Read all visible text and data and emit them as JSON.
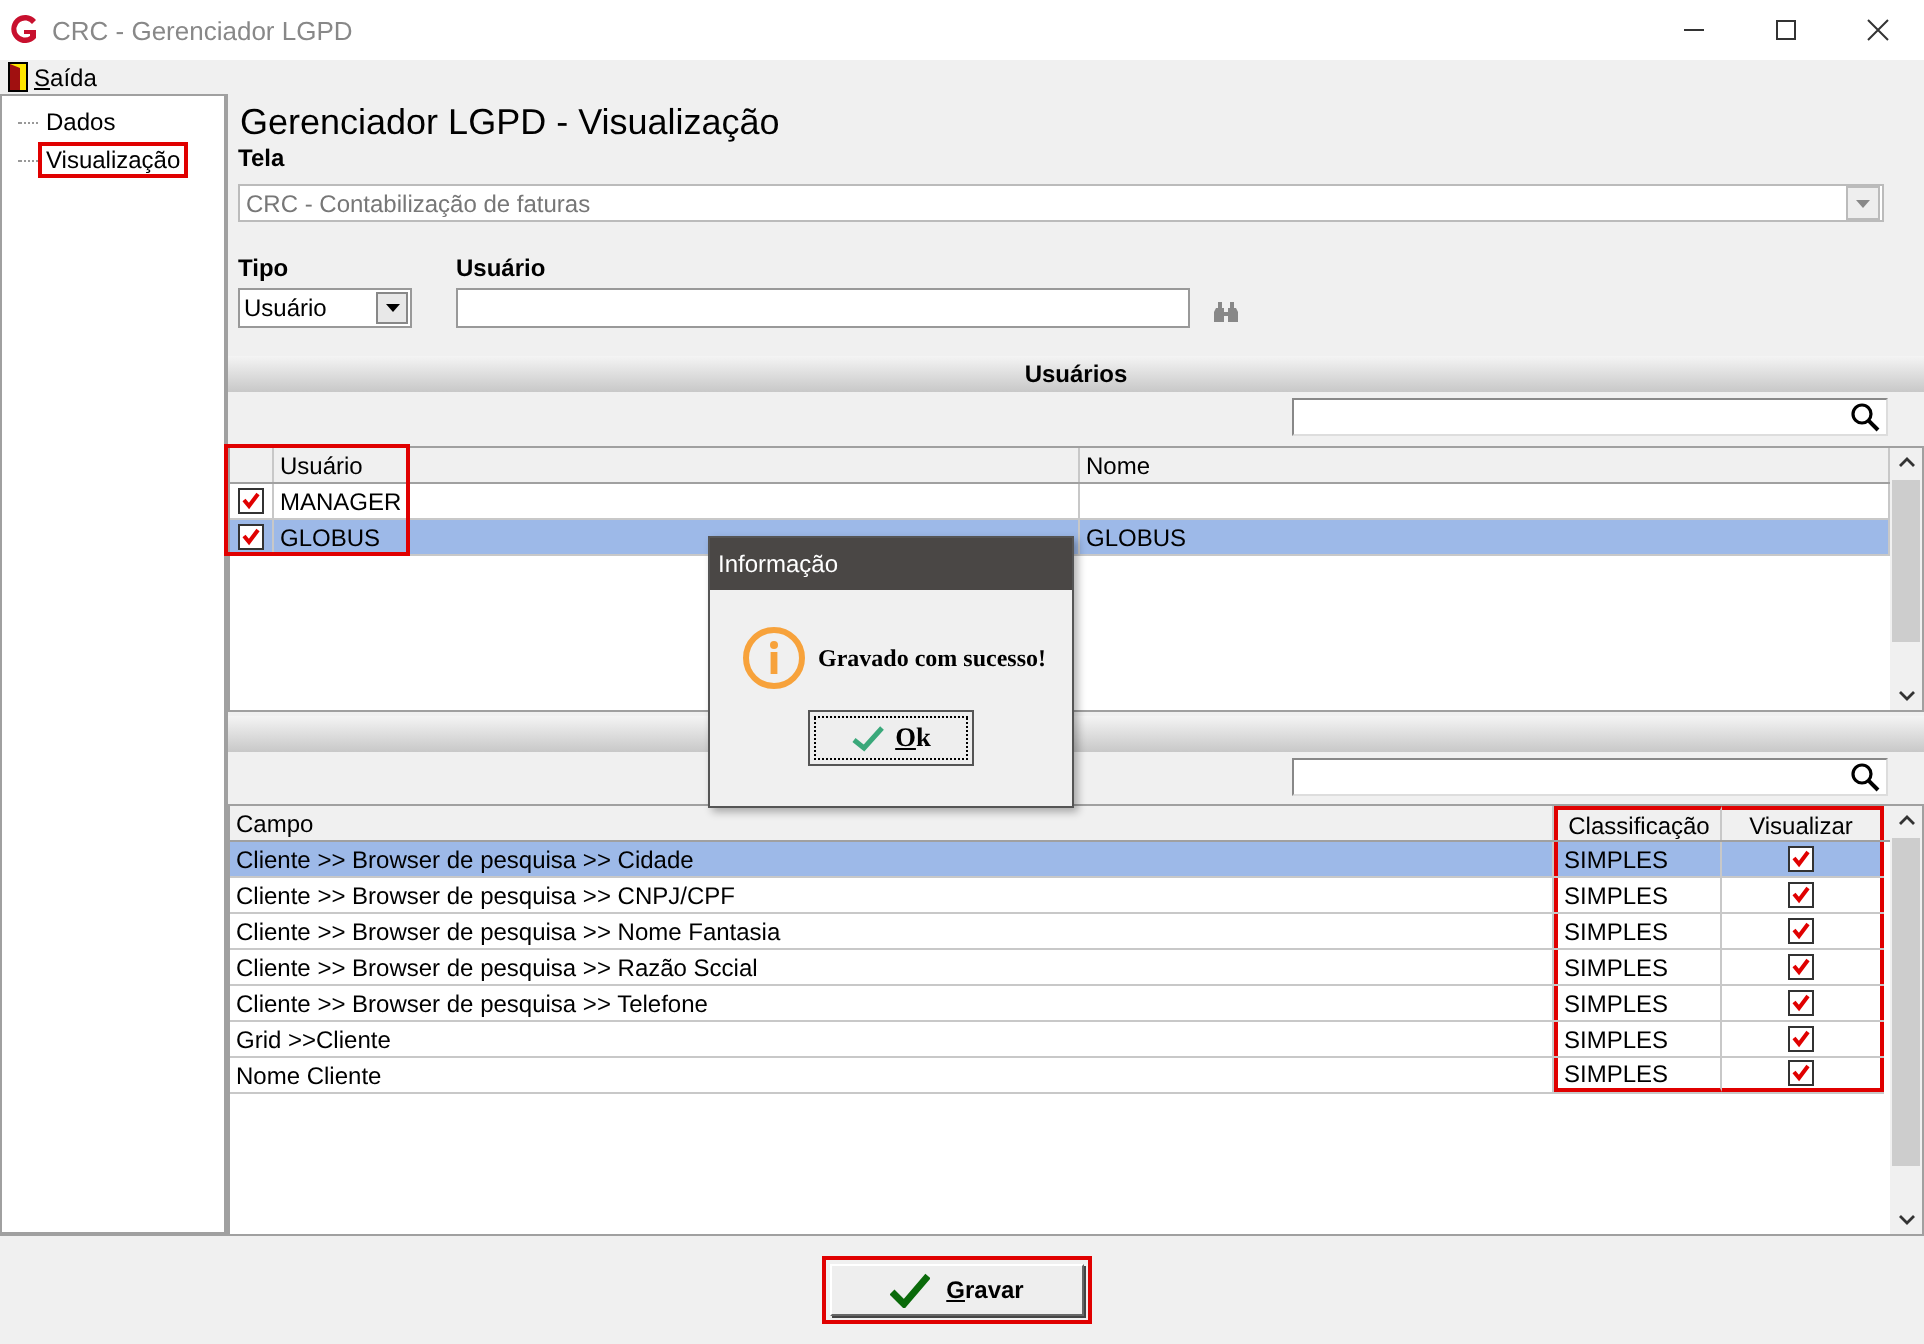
{
  "window": {
    "title": "CRC - Gerenciador LGPD"
  },
  "menu": [
    {
      "label": "Saída"
    }
  ],
  "tree": [
    {
      "label": "Dados",
      "marked": false
    },
    {
      "label": "Visualização",
      "marked": true
    }
  ],
  "heading": "Gerenciador LGPD - Visualização",
  "tela": {
    "label": "Tela",
    "value": "CRC - Contabilização de faturas",
    "disabled": true
  },
  "tipo": {
    "label": "Tipo",
    "value": "Usuário"
  },
  "usuario": {
    "label": "Usuário"
  },
  "users": {
    "title": "Usuários",
    "marked": true,
    "columns": [
      "Usuário",
      "Nome"
    ],
    "rows": [
      {
        "usuario": "MANAGER",
        "checked": true,
        "selected": false
      },
      {
        "usuario": "GLOBUS",
        "nome": "GLOBUS",
        "checked": true,
        "selected": true
      }
    ]
  },
  "fields": {
    "marked": true,
    "columns": [
      "Campo",
      "Classificação",
      "Visualizar"
    ],
    "rows": [
      {
        "campo": "Cliente >> Browser de pesquisa >> Cidade",
        "classificacao": "SIMPLES",
        "visualizar": true,
        "selected": true
      },
      {
        "campo": "Cliente >> Browser de pesquisa >> CNPJ/CPF",
        "classificacao": "SIMPLES",
        "visualizar": true,
        "selected": false
      },
      {
        "campo": "Cliente >> Browser de pesquisa >> Nome Fantasia",
        "classificacao": "SIMPLES",
        "visualizar": true,
        "selected": false
      },
      {
        "campo": "Cliente >> Browser de pesquisa >> Razão Sccial",
        "classificacao": "SIMPLES",
        "visualizar": true,
        "selected": false
      },
      {
        "campo": "Cliente >> Browser de pesquisa >> Telefone",
        "classificacao": "SIMPLES",
        "visualizar": true,
        "selected": false
      },
      {
        "campo": "Grid >>Cliente",
        "classificacao": "SIMPLES",
        "visualizar": true,
        "selected": false
      },
      {
        "campo": "Nome Cliente",
        "classificacao": "SIMPLES",
        "visualizar": true,
        "selected": false
      }
    ]
  },
  "dialog": {
    "title": "Informação",
    "message": "Gravado com sucesso!",
    "button": "Ok"
  },
  "save_button": {
    "label": "Gravar",
    "marked": true
  }
}
